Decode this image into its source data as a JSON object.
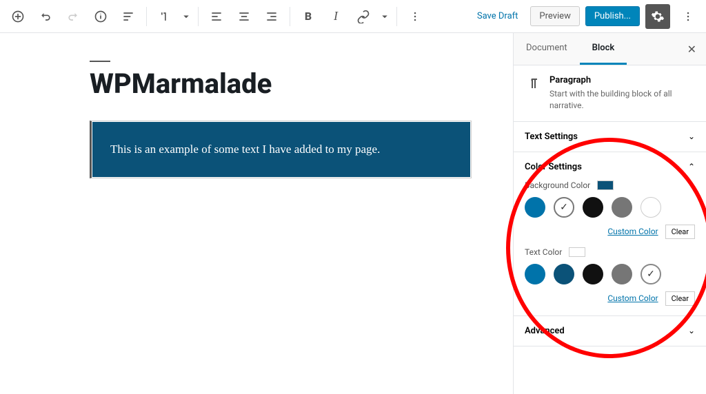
{
  "toolbar": {
    "save_draft": "Save Draft",
    "preview": "Preview",
    "publish": "Publish..."
  },
  "editor": {
    "title": "WPMarmalade",
    "paragraph": "This is an example of some text I have added to my page."
  },
  "sidebar": {
    "tabs": {
      "document": "Document",
      "block": "Block"
    },
    "block_name": "Paragraph",
    "block_desc": "Start with the building block of all narrative.",
    "panels": {
      "text_settings": "Text Settings",
      "color_settings": "Color Settings",
      "advanced": "Advanced"
    },
    "bg_color_label": "Background Color",
    "text_color_label": "Text Color",
    "custom_color": "Custom Color",
    "clear": "Clear",
    "bg_swatch": "#0b5278",
    "text_swatch": "#ffffff",
    "palette": [
      "#0073aa",
      "#0b5278",
      "#111111",
      "#767676",
      "#ffffff"
    ]
  }
}
